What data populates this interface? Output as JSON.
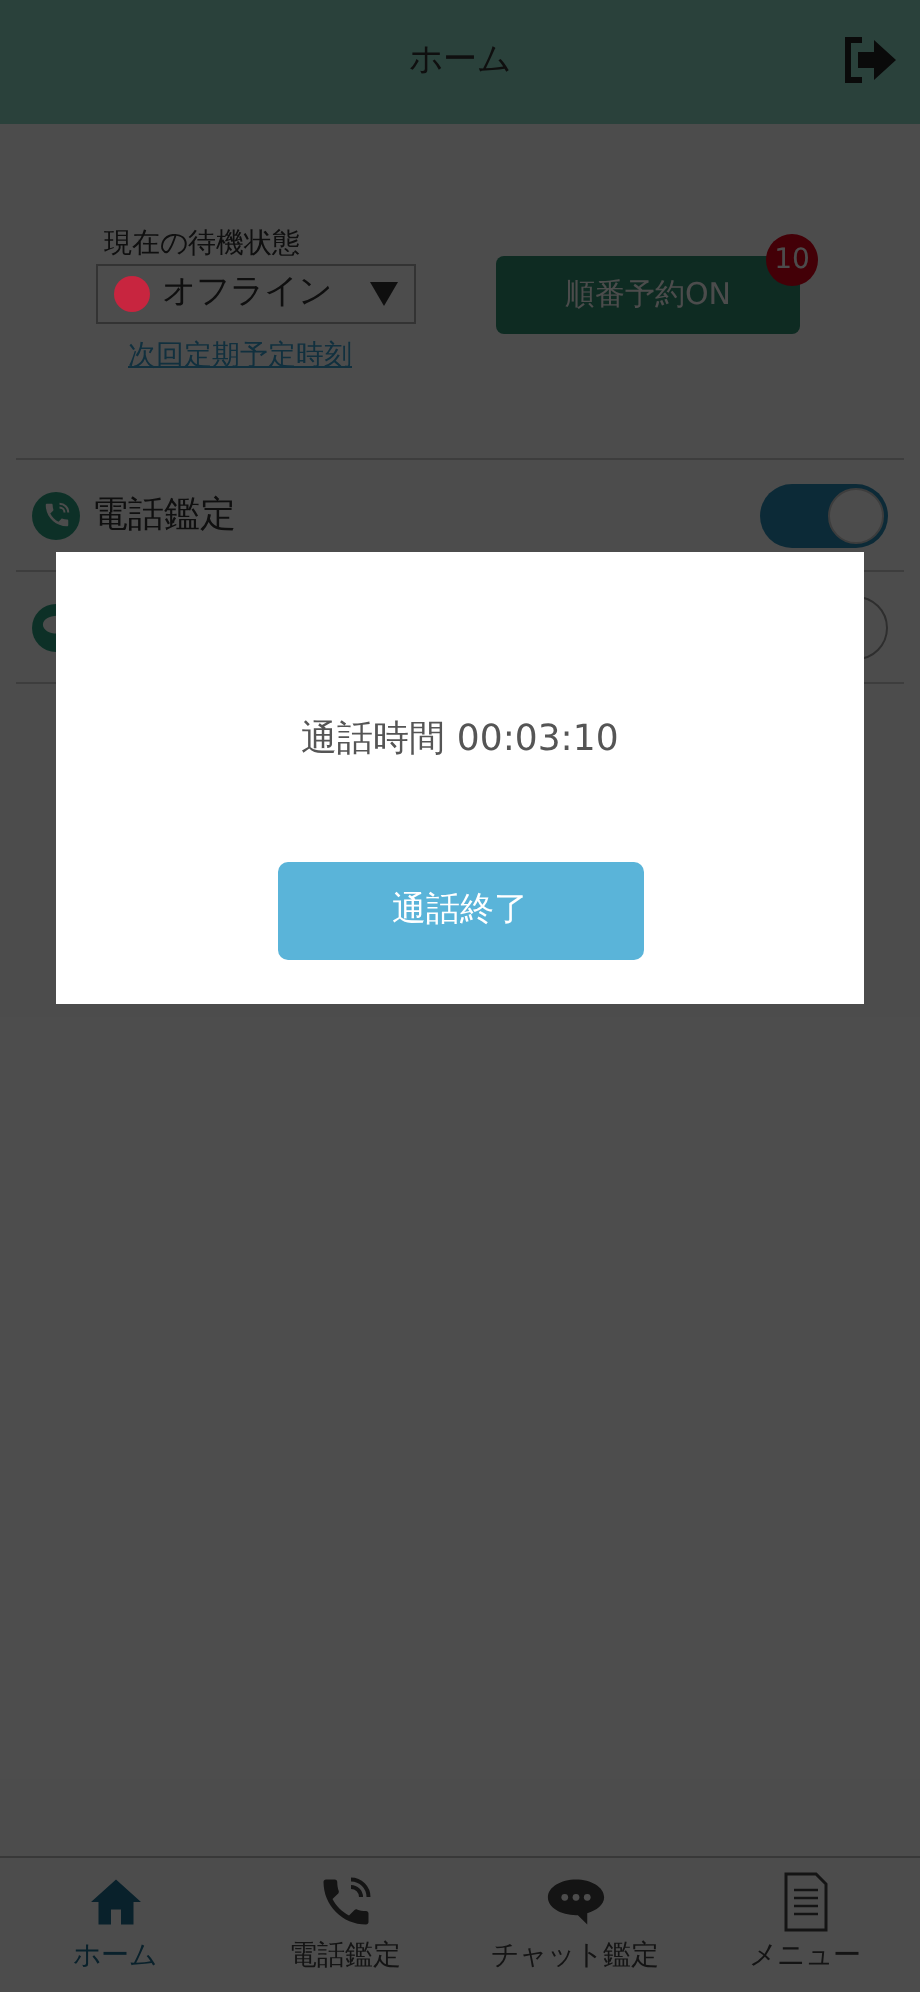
{
  "header": {
    "title": "ホーム"
  },
  "standby": {
    "label": "現在の待機状態",
    "status": "オフライン",
    "color": "#c8253f",
    "link": "次回定期予定時刻"
  },
  "reserve": {
    "label": "順番予約ON",
    "badge": "10"
  },
  "services": [
    {
      "kind": "phone",
      "label": "電話鑑定",
      "on": true
    },
    {
      "kind": "chat",
      "on": false
    }
  ],
  "dialog": {
    "text": "通話時間 00:03:10",
    "button": "通話終了"
  },
  "nav": [
    {
      "kind": "home",
      "label": "ホーム",
      "selected": true
    },
    {
      "kind": "phone",
      "label": "電話鑑定",
      "selected": false
    },
    {
      "kind": "chat",
      "label": "チャット鑑定",
      "selected": false
    },
    {
      "kind": "menu",
      "label": "メニュー",
      "selected": false
    }
  ]
}
